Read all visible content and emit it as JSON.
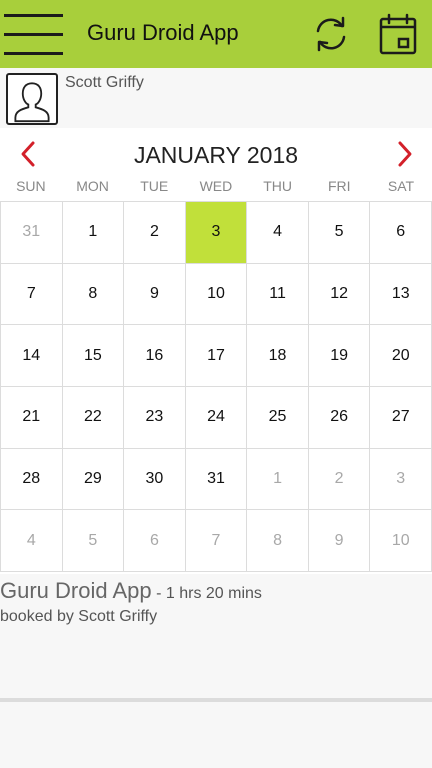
{
  "appbar": {
    "title": "Guru Droid App",
    "menu_icon": "hamburger-menu-icon",
    "refresh_icon": "refresh-icon",
    "calendar_icon": "calendar-icon",
    "color": "#a8cf3b"
  },
  "user": {
    "name": "Scott Griffy",
    "avatar_icon": "user-silhouette-icon"
  },
  "calendar": {
    "month_label": "JANUARY 2018",
    "prev_icon": "chevron-left-icon",
    "next_icon": "chevron-right-icon",
    "nav_color": "#d3202a",
    "selected_color": "#c1e03a",
    "weekdays": [
      "SUN",
      "MON",
      "TUE",
      "WED",
      "THU",
      "FRI",
      "SAT"
    ],
    "days": [
      {
        "label": "31",
        "muted": true
      },
      {
        "label": "1"
      },
      {
        "label": "2"
      },
      {
        "label": "3",
        "selected": true
      },
      {
        "label": "4"
      },
      {
        "label": "5"
      },
      {
        "label": "6"
      },
      {
        "label": "7"
      },
      {
        "label": "8"
      },
      {
        "label": "9"
      },
      {
        "label": "10"
      },
      {
        "label": "11"
      },
      {
        "label": "12"
      },
      {
        "label": "13"
      },
      {
        "label": "14"
      },
      {
        "label": "15"
      },
      {
        "label": "16"
      },
      {
        "label": "17"
      },
      {
        "label": "18"
      },
      {
        "label": "19"
      },
      {
        "label": "20"
      },
      {
        "label": "21"
      },
      {
        "label": "22"
      },
      {
        "label": "23"
      },
      {
        "label": "24"
      },
      {
        "label": "25"
      },
      {
        "label": "26"
      },
      {
        "label": "27"
      },
      {
        "label": "28"
      },
      {
        "label": "29"
      },
      {
        "label": "30"
      },
      {
        "label": "31"
      },
      {
        "label": "1",
        "muted": true
      },
      {
        "label": "2",
        "muted": true
      },
      {
        "label": "3",
        "muted": true
      },
      {
        "label": "4",
        "muted": true
      },
      {
        "label": "5",
        "muted": true
      },
      {
        "label": "6",
        "muted": true
      },
      {
        "label": "7",
        "muted": true
      },
      {
        "label": "8",
        "muted": true
      },
      {
        "label": "9",
        "muted": true
      },
      {
        "label": "10",
        "muted": true
      }
    ]
  },
  "booking": {
    "title": "Guru Droid App",
    "duration": "- 1 hrs 20 mins",
    "booked_by": "booked by Scott Griffy"
  }
}
